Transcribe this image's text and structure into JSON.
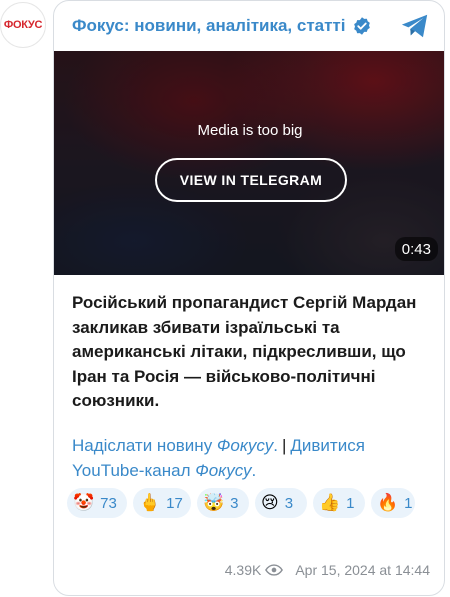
{
  "channel": {
    "avatar_text": "ФОКУС",
    "title": "Фокус: новини, аналітика, статті"
  },
  "media": {
    "note": "Media is too big",
    "button_label": "VIEW IN TELEGRAM",
    "duration": "0:43"
  },
  "post": {
    "text": "Російський пропагандист Сергій Мардан закликав збивати ізраїльські та американські літаки, підкресливши, що Іран та Росія — військово-політичні союзники."
  },
  "links": {
    "send_prefix": "Надіслати новину ",
    "send_italic": "Фокусу",
    "send_suffix": ".",
    "separator": "|",
    "watch_prefix": "Дивитися YouTube-канал ",
    "watch_italic": "Фокусу",
    "watch_suffix": "."
  },
  "reactions": [
    {
      "icon": "clown-face-icon",
      "emoji": "🤡",
      "count": "73"
    },
    {
      "icon": "middle-finger-icon",
      "emoji": "🖕",
      "count": "17"
    },
    {
      "icon": "exploding-head-icon",
      "emoji": "🤯",
      "count": "3"
    },
    {
      "icon": "crying-face-icon",
      "emoji": "😢",
      "count": "3"
    },
    {
      "icon": "thumbs-up-icon",
      "emoji": "👍",
      "count": "1"
    },
    {
      "icon": "fire-icon",
      "emoji": "🔥",
      "count": "1"
    }
  ],
  "footer": {
    "views": "4.39K",
    "date": "Apr 15, 2024 at 14:44"
  },
  "colors": {
    "link": "#3a89c9",
    "reaction_bg": "#eaf3fb",
    "brand_red": "#d6262d"
  }
}
